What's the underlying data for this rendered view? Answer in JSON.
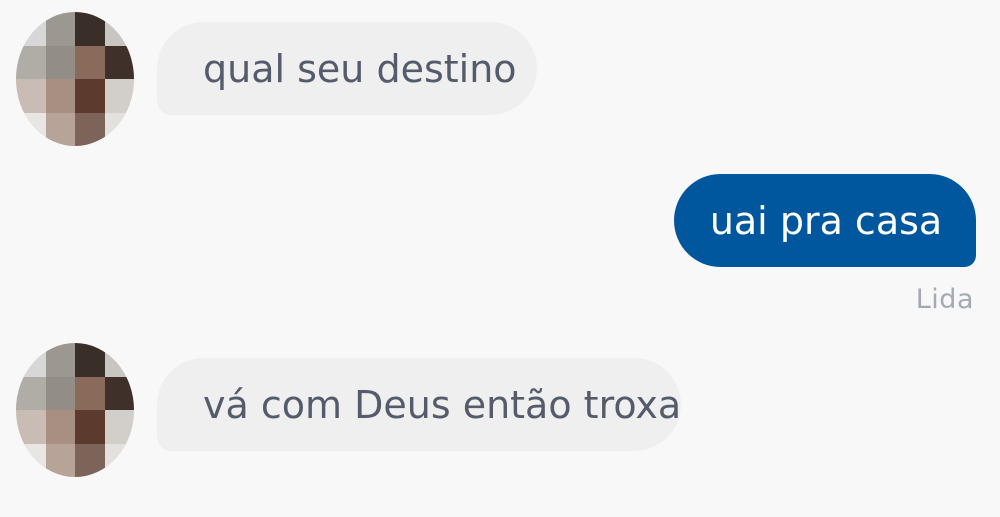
{
  "messages": [
    {
      "direction": "incoming",
      "text": "qual seu destino"
    },
    {
      "direction": "outgoing",
      "text": "uai pra casa"
    },
    {
      "direction": "incoming",
      "text": "vá com Deus então troxa"
    }
  ],
  "read_status": "Lida",
  "avatar": {
    "description_icon": "pixelated-avatar",
    "pixel_colors": [
      "#d7d7d7",
      "#9c9890",
      "#3a2e28",
      "#c9c6c1",
      "#b0aca6",
      "#928e87",
      "#8a6a5a",
      "#3f3129",
      "#c8bcb4",
      "#a88f82",
      "#5c3a2e",
      "#d2cfca",
      "#e8e6e3",
      "#b8a399",
      "#7d6458",
      "#e3e1de"
    ]
  },
  "colors": {
    "background": "#f8f8f8",
    "incoming_bubble": "#efefef",
    "outgoing_bubble": "#00579e",
    "incoming_text": "#545b6a",
    "status_text": "#a5a9b1"
  }
}
